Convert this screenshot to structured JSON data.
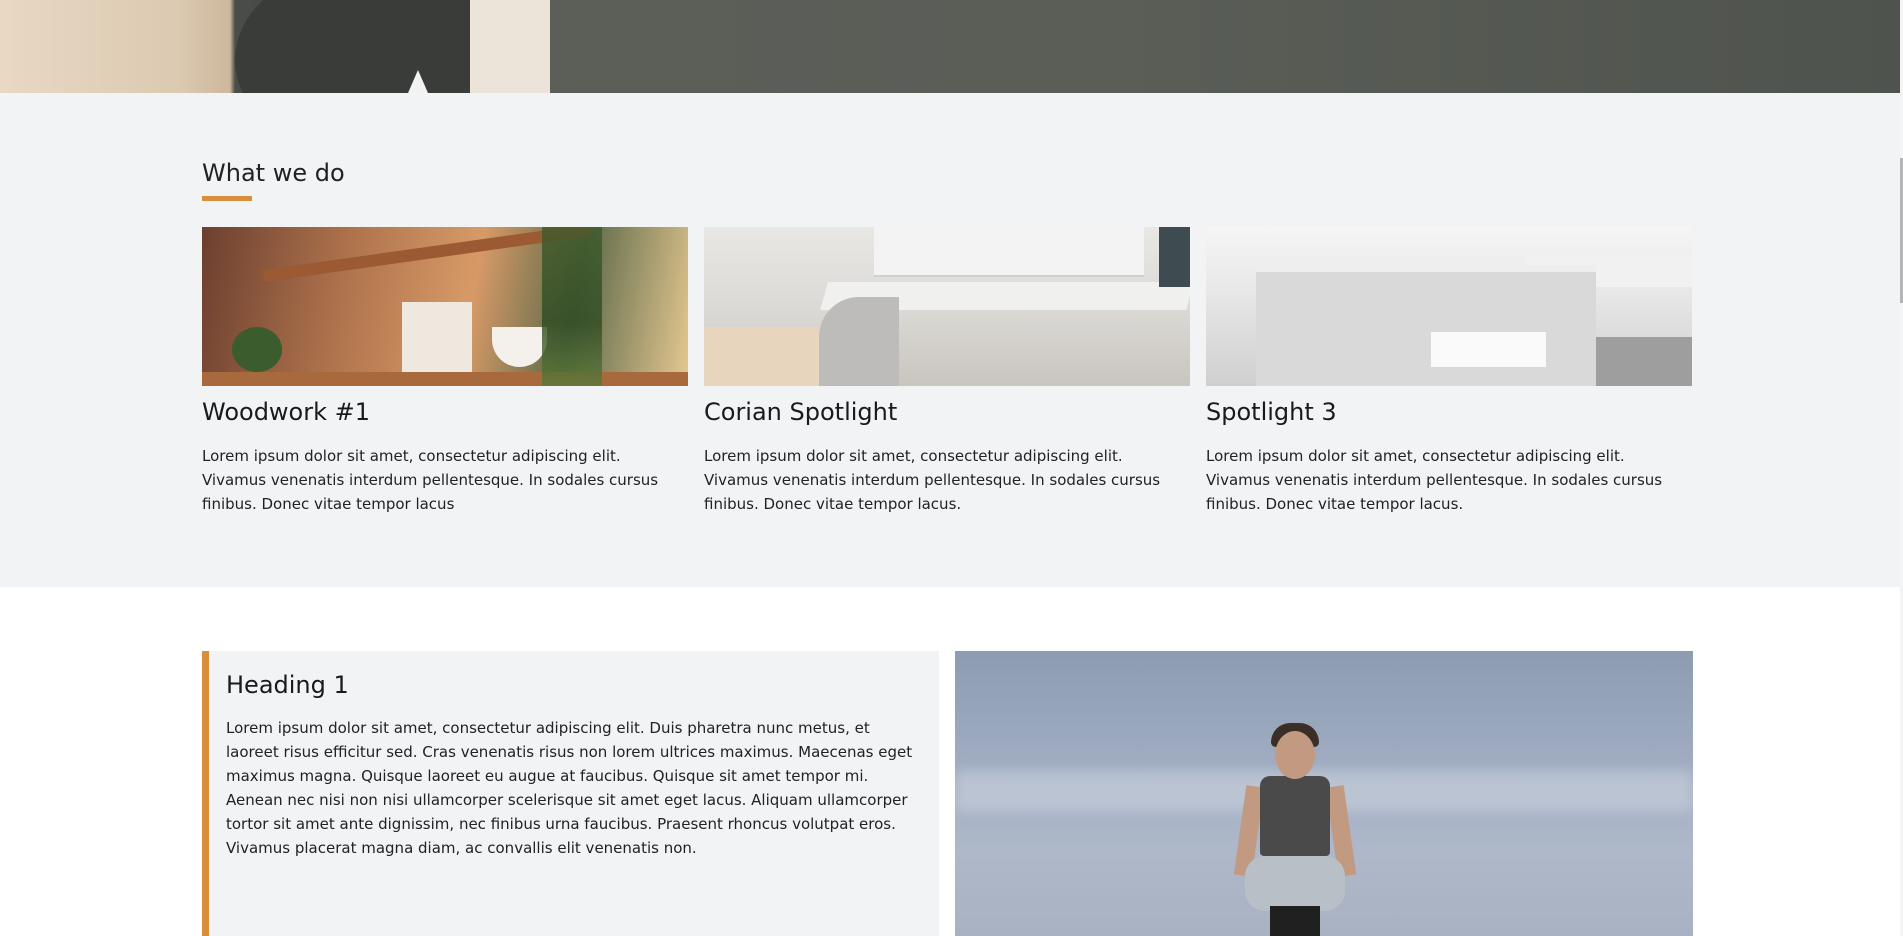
{
  "what_we_do": {
    "title": "What we do",
    "cards": [
      {
        "image": "shelf-decor-image",
        "title": "Woodwork #1",
        "text": "Lorem ipsum dolor sit amet, consectetur adipiscing elit. Vivamus venenatis interdum pellentesque. In sodales cursus finibus. Donec vitae tempor lacus"
      },
      {
        "image": "kitchen-image",
        "title": "Corian Spotlight",
        "text": "Lorem ipsum dolor sit amet, consectetur adipiscing elit. Vivamus venenatis interdum pellentesque. In sodales cursus finibus. Donec vitae tempor lacus."
      },
      {
        "image": "bathroom-image",
        "title": "Spotlight 3",
        "text": "Lorem ipsum dolor sit amet, consectetur adipiscing elit. Vivamus venenatis interdum pellentesque. In sodales cursus finibus. Donec vitae tempor lacus."
      }
    ]
  },
  "feature": {
    "heading": "Heading 1",
    "text": "Lorem ipsum dolor sit amet, consectetur adipiscing elit. Duis pharetra nunc metus, et laoreet risus efficitur sed. Cras venenatis risus non lorem ultrices maximus. Maecenas eget maximus magna. Quisque laoreet eu augue at faucibus. Quisque sit amet tempor mi. Aenean nec nisi non nisi ullamcorper scelerisque sit amet eget lacus. Aliquam ullamcorper tortor sit amet ante dignissim, nec finibus urna faucibus. Praesent rhoncus volutpat eros. Vivamus placerat magna diam, ac convallis elit venenatis non.",
    "image": "jumping-person-photo"
  },
  "colors": {
    "accent": "#d98e3b",
    "section_bg": "#f2f3f5",
    "text": "#222222"
  }
}
